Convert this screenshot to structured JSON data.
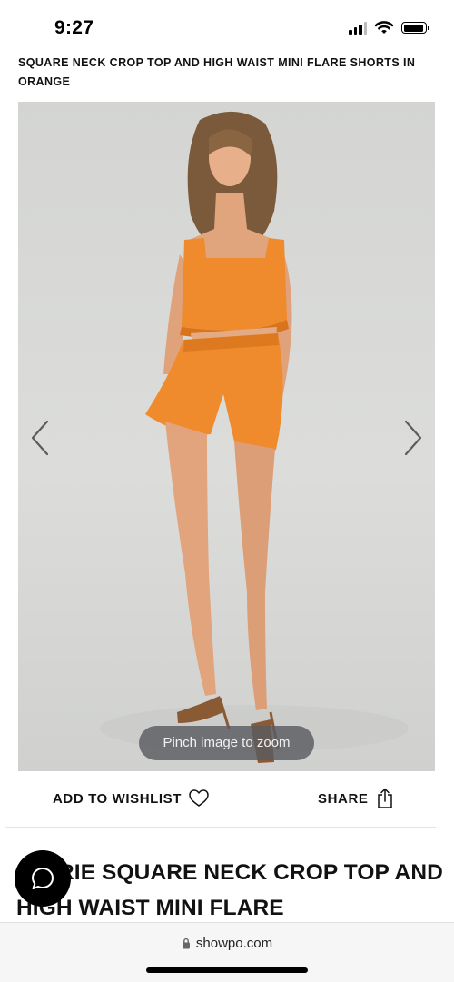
{
  "status": {
    "time": "9:27"
  },
  "product": {
    "title_caps": "SQUARE NECK CROP TOP AND HIGH WAIST MINI FLARE SHORTS IN ORANGE",
    "heading": "RIE SQUARE NECK CROP TOP AND HIGH WAIST MINI FLARE",
    "zoom_hint": "Pinch image to zoom",
    "color_accent": "#ef8b2c"
  },
  "actions": {
    "wishlist_label": "ADD TO WISHLIST",
    "share_label": "SHARE"
  },
  "icons": {
    "prev": "chevron-left-icon",
    "next": "chevron-right-icon",
    "wishlist": "heart-icon",
    "share": "share-icon",
    "chat": "chat-bubble-icon",
    "lock": "lock-icon"
  },
  "browser": {
    "url": "showpo.com"
  }
}
